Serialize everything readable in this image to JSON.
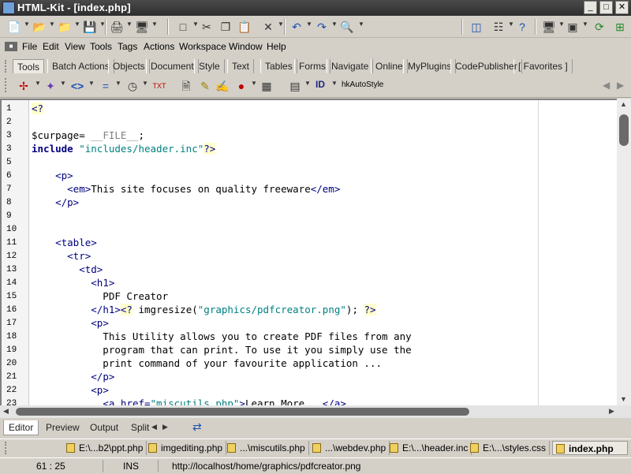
{
  "window": {
    "title": "HTML-Kit - [index.php]",
    "controls": [
      "_",
      "□",
      "✕"
    ]
  },
  "menu": [
    "File",
    "Edit",
    "View",
    "Tools",
    "Tags",
    "Actions",
    "Workspace",
    "Window",
    "Help"
  ],
  "tabs": [
    "Tools",
    "Batch Actions",
    "Objects",
    "Document",
    "Style",
    "Text",
    "Tables",
    "Forms",
    "Navigate",
    "Online",
    "MyPlugins",
    "CodePublisher",
    "[ Favorites ]"
  ],
  "tools_toolbar": {
    "id_label": "ID",
    "autostyle_label": "hkAutoStyle"
  },
  "code_lines": [
    {
      "n": "1",
      "html": "<span class=\"php\">&lt;?</span>"
    },
    {
      "n": "2",
      "html": ""
    },
    {
      "n": "3",
      "html": "<span class=\"var\">$curpage</span>= <span class=\"mac\">__FILE__</span>;"
    },
    {
      "n": "3",
      "html": "<span class=\"kw\">include</span> <span class=\"str\">\"includes/header.inc\"</span><span class=\"php\">?&gt;</span>"
    },
    {
      "n": "5",
      "html": ""
    },
    {
      "n": "6",
      "html": "    <span class=\"tag\">&lt;p&gt;</span>"
    },
    {
      "n": "7",
      "html": "      <span class=\"tag\">&lt;em&gt;</span>This site focuses on quality freeware<span class=\"tag\">&lt;/em&gt;</span>"
    },
    {
      "n": "8",
      "html": "    <span class=\"tag\">&lt;/p&gt;</span>"
    },
    {
      "n": "9",
      "html": ""
    },
    {
      "n": "10",
      "html": ""
    },
    {
      "n": "11",
      "html": "    <span class=\"tag\">&lt;table&gt;</span>"
    },
    {
      "n": "12",
      "html": "      <span class=\"tag\">&lt;tr&gt;</span>"
    },
    {
      "n": "13",
      "html": "        <span class=\"tag\">&lt;td&gt;</span>"
    },
    {
      "n": "14",
      "html": "          <span class=\"tag\">&lt;h1&gt;</span>"
    },
    {
      "n": "15",
      "html": "            PDF Creator"
    },
    {
      "n": "16",
      "html": "          <span class=\"tag\">&lt;/h1&gt;</span><span class=\"php\">&lt;?</span> imgresize(<span class=\"str\">\"graphics/pdfcreator.png\"</span>); <span class=\"php\">?&gt;</span>"
    },
    {
      "n": "17",
      "html": "          <span class=\"tag\">&lt;p&gt;</span>"
    },
    {
      "n": "18",
      "html": "            This Utility allows you to create PDF files from any"
    },
    {
      "n": "19",
      "html": "            program that can print. To use it you simply use the"
    },
    {
      "n": "20",
      "html": "            print command of your favourite application ..."
    },
    {
      "n": "21",
      "html": "          <span class=\"tag\">&lt;/p&gt;</span>"
    },
    {
      "n": "22",
      "html": "          <span class=\"tag\">&lt;p&gt;</span>"
    },
    {
      "n": "23",
      "html": "            <span class=\"tag\">&lt;a href=</span><span class=\"str\">\"miscutils.php\"</span><span class=\"tag\">&gt;</span>Learn More...<span class=\"tag\">&lt;/a&gt;</span>"
    }
  ],
  "bottom_tabs": [
    "Editor",
    "Preview",
    "Output",
    "Split"
  ],
  "file_tabs": [
    "E:\\...b2\\ppt.php",
    "imgediting.php",
    "...\\miscutils.php",
    "...\\webdev.php",
    "E:\\...\\header.inc",
    "E:\\...\\styles.css",
    "index.php"
  ],
  "status": {
    "position": "61 : 25",
    "mode": "INS",
    "url": "http://localhost/home/graphics/pdfcreator.png"
  }
}
